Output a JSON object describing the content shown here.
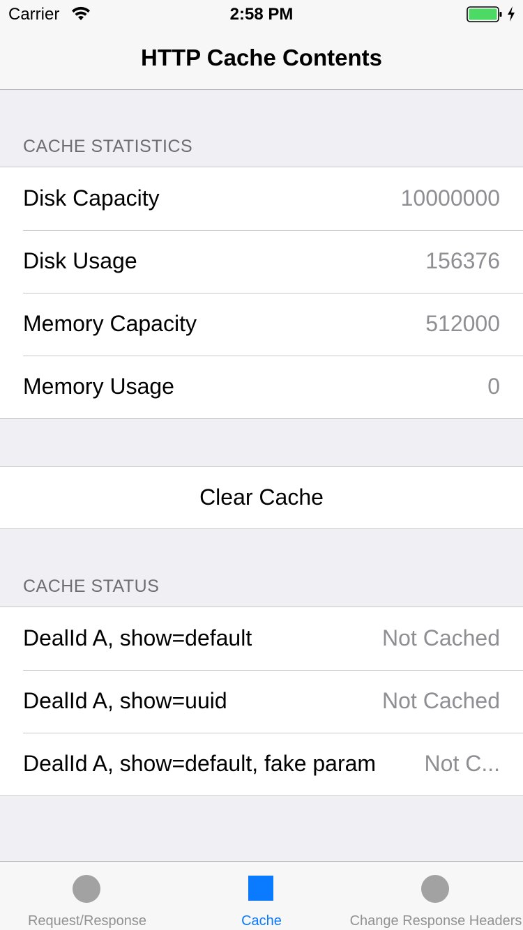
{
  "status_bar": {
    "carrier": "Carrier",
    "time": "2:58 PM",
    "battery_color": "#4cd964"
  },
  "nav": {
    "title": "HTTP Cache Contents"
  },
  "statistics": {
    "header": "CACHE STATISTICS",
    "rows": [
      {
        "label": "Disk Capacity",
        "value": "10000000"
      },
      {
        "label": "Disk Usage",
        "value": "156376"
      },
      {
        "label": "Memory Capacity",
        "value": "512000"
      },
      {
        "label": "Memory Usage",
        "value": "0"
      }
    ]
  },
  "actions": {
    "clear_cache": "Clear Cache"
  },
  "status": {
    "header": "CACHE STATUS",
    "rows": [
      {
        "label": "DealId A, show=default",
        "value": "Not Cached"
      },
      {
        "label": "DealId A, show=uuid",
        "value": "Not Cached"
      },
      {
        "label": "DealId A, show=default, fake param",
        "value": "Not C..."
      }
    ]
  },
  "tab_bar": {
    "accent_color": "#0a7aff",
    "tabs": [
      {
        "label": "Request/Response",
        "icon": "circle-icon",
        "selected": false
      },
      {
        "label": "Cache",
        "icon": "square-icon",
        "selected": true
      },
      {
        "label": "Change Response Headers",
        "icon": "circle-icon",
        "selected": false
      }
    ]
  }
}
